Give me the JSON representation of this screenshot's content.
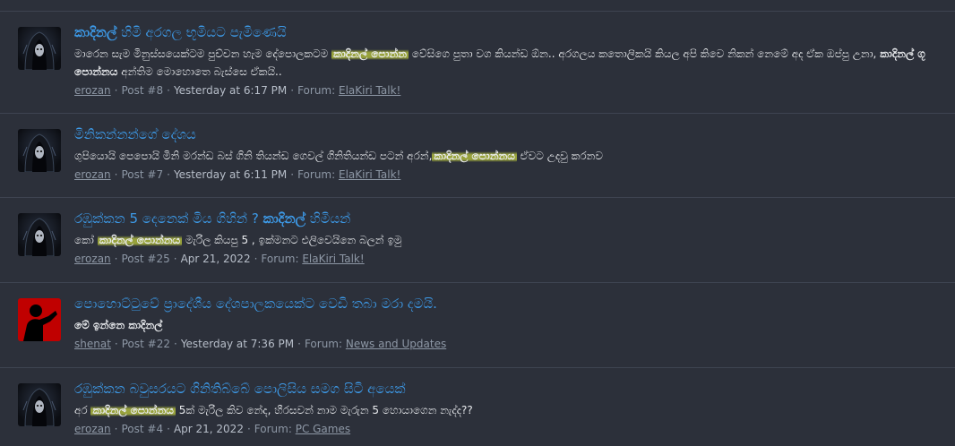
{
  "results": [
    {
      "title_normal": "",
      "title_bold": "කාදිනල්",
      "title_rest": " හිමි අරගල භූමියට පැමිණෙයි",
      "snippet": [
        {
          "t": "මාරෙන සැම මිනුස්සයෙක්ටම පුච්චන හැම දේපොලකටම ",
          "s": "n"
        },
        {
          "t": "කාදිනල් පොන්න",
          "s": "h"
        },
        {
          "t": " වේසිගෙ පුතා වග කියන්ඩ ඕන.. අරගලය කතොලිකයි කියල අපි කිවෙ නිකන් නෙමේ අද ඒක ඔප්පු උනා, ",
          "s": "n"
        },
        {
          "t": "කාදිනල් ගූ පොන්නය",
          "s": "b"
        },
        {
          "t": " අන්තිම මොහොතෙ බැස්සෙ ඒකයි..",
          "s": "n"
        }
      ],
      "user": "erozan",
      "post": "Post #8",
      "time": "Yesterday at 6:17 PM",
      "forum_label": "Forum:",
      "forum": "ElaKiri Talk!",
      "avatar": "hooded"
    },
    {
      "title_normal": "මිනිකන්නන්ගේ දේශය",
      "title_bold": "",
      "title_rest": "",
      "snippet": [
        {
          "t": "ගුපියොයි පෙපොයි මිනි මරන්ඩ බස් ගිනි තියන්ඩ ගෙවල් ගිනිතියන්ඩ පටන් අරන්,",
          "s": "n"
        },
        {
          "t": "කාදිනල් පොන්නය",
          "s": "h"
        },
        {
          "t": " ඒවට උදවු කරනව",
          "s": "n"
        }
      ],
      "user": "erozan",
      "post": "Post #7",
      "time": "Yesterday at 6:11 PM",
      "forum_label": "Forum:",
      "forum": "ElaKiri Talk!",
      "avatar": "hooded"
    },
    {
      "title_normal": "රඹුක්කන 5 දෙනෙක් මිය ගිහින් ? ",
      "title_bold": "කාදිනල්",
      "title_rest": " හිමියන්",
      "snippet": [
        {
          "t": "කෝ ",
          "s": "n"
        },
        {
          "t": "කාදිනල් පොන්නය",
          "s": "h"
        },
        {
          "t": " මැරිල කියපු 5 , ඉක්මනට එලිවෙයිනෙ බලන් ඉමු",
          "s": "n"
        }
      ],
      "user": "erozan",
      "post": "Post #25",
      "time": "Apr 21, 2022",
      "forum_label": "Forum:",
      "forum": "ElaKiri Talk!",
      "avatar": "hooded"
    },
    {
      "title_normal": "පොහොට්ටුවේ ප්‍රාදේශීය දේශපාලකයෙක්ට වෙඩි තබා මරා දමයි.",
      "title_bold": "",
      "title_rest": "",
      "snippet": [
        {
          "t": "මේ ඉන්නෙ කාදිනල්",
          "s": "b"
        }
      ],
      "user": "shenat",
      "post": "Post #22",
      "time": "Yesterday at 7:36 PM",
      "forum_label": "Forum:",
      "forum": "News and Updates",
      "avatar": "red"
    },
    {
      "title_normal": "රඹුක්කන බවුසරයට ගිනිතිබ්බේ පොලිසිය සමග සිටි අයෙක්",
      "title_bold": "",
      "title_rest": "",
      "snippet": [
        {
          "t": "අර ",
          "s": "n"
        },
        {
          "t": "කාදිනල් පොන්නය",
          "s": "h"
        },
        {
          "t": " 5ක් මැරිල කිව නේද, හීරසවන් නාම මැරුන 5 හොයාගෙන නැද්ද??",
          "s": "n"
        }
      ],
      "user": "erozan",
      "post": "Post #4",
      "time": "Apr 21, 2022",
      "forum_label": "Forum:",
      "forum": "PC Games",
      "avatar": "hooded"
    }
  ]
}
